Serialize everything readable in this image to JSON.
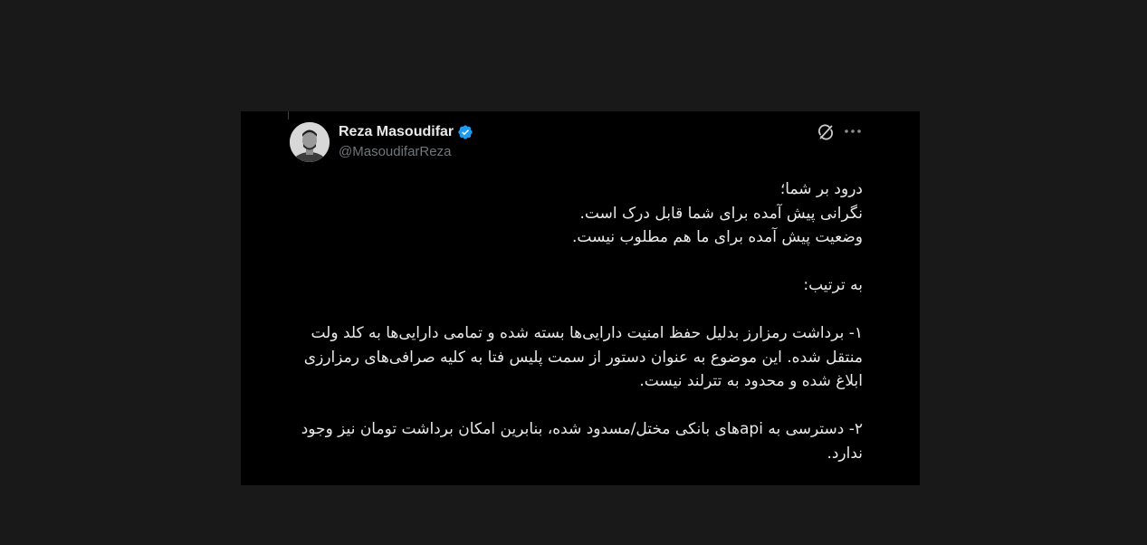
{
  "author": {
    "display_name": "Reza Masoudifar",
    "handle": "@MasoudifarReza",
    "verified": true,
    "verified_color": "#1d9bf0"
  },
  "icons": {
    "grok": "grok-icon",
    "more": "more-icon",
    "verified": "verified-badge-icon"
  },
  "tweet": {
    "lines": [
      "درود بر شما؛",
      "نگرانی پیش آمده برای شما قابل درک است.",
      "وضعیت پیش آمده برای ما هم مطلوب نیست.",
      "",
      "به ترتیب:",
      "",
      "۱- برداشت رمزارز بدلیل حفظ امنیت دارایی‌ها بسته شده و تمامی دارایی‌ها به کلد ولت منتقل شده. این موضوع به عنوان دستور از سمت پلیس فتا به کلیه صرافی‌های رمزارزی ابلاغ شده و محدود به تترلند نیست.",
      "",
      "۲- دسترسی به apiهای بانکی مختل/مسدود شده، بنابرین امکان برداشت تومان نیز وجود ندارد."
    ]
  },
  "colors": {
    "page_bg": "#191919",
    "card_bg": "#000000",
    "text": "#e7e9ea",
    "muted": "#71767b"
  }
}
